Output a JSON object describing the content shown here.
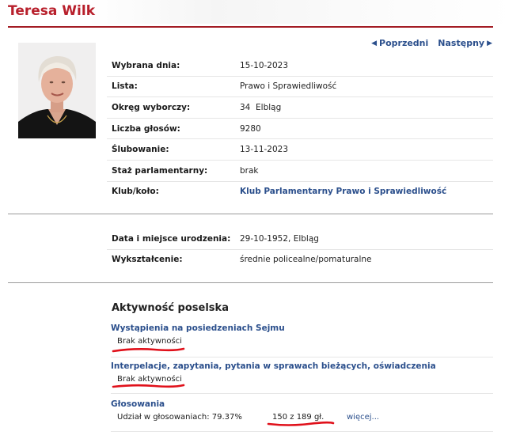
{
  "profile": {
    "name": "Teresa Wilk"
  },
  "nav": {
    "prev": "Poprzedni",
    "next": "Następny"
  },
  "details": [
    {
      "label": "Wybrana dnia:",
      "value": "15-10-2023"
    },
    {
      "label": "Lista:",
      "value": "Prawo i Sprawiedliwość"
    },
    {
      "label": "Okręg wyborczy:",
      "value": "34  Elbląg"
    },
    {
      "label": "Liczba głosów:",
      "value": "9280"
    },
    {
      "label": "Ślubowanie:",
      "value": "13-11-2023"
    },
    {
      "label": "Staż parlamentarny:",
      "value": "brak"
    },
    {
      "label": "Klub/koło:",
      "value": "Klub Parlamentarny Prawo i Sprawiedliwość"
    }
  ],
  "personal": [
    {
      "label": "Data i miejsce urodzenia:",
      "value": "29-10-1952, Elbląg"
    },
    {
      "label": "Wykształcenie:",
      "value": "średnie policealne/pomaturalne"
    }
  ],
  "activity": {
    "title": "Aktywność poselska",
    "speeches": {
      "heading": "Wystąpienia na posiedzeniach Sejmu",
      "value": "Brak aktywności"
    },
    "interpellations": {
      "heading": "Interpelacje, zapytania, pytania w sprawach bieżących, oświadczenia",
      "value": "Brak aktywności"
    },
    "votes": {
      "heading": "Głosowania",
      "participation": "Udział w głosowaniach: 79.37%",
      "count": "150 z 189 gł.",
      "more": "więcej..."
    }
  },
  "colors": {
    "title": "#b8202c",
    "link": "#2b4f8c",
    "annotation": "#e0101a"
  }
}
